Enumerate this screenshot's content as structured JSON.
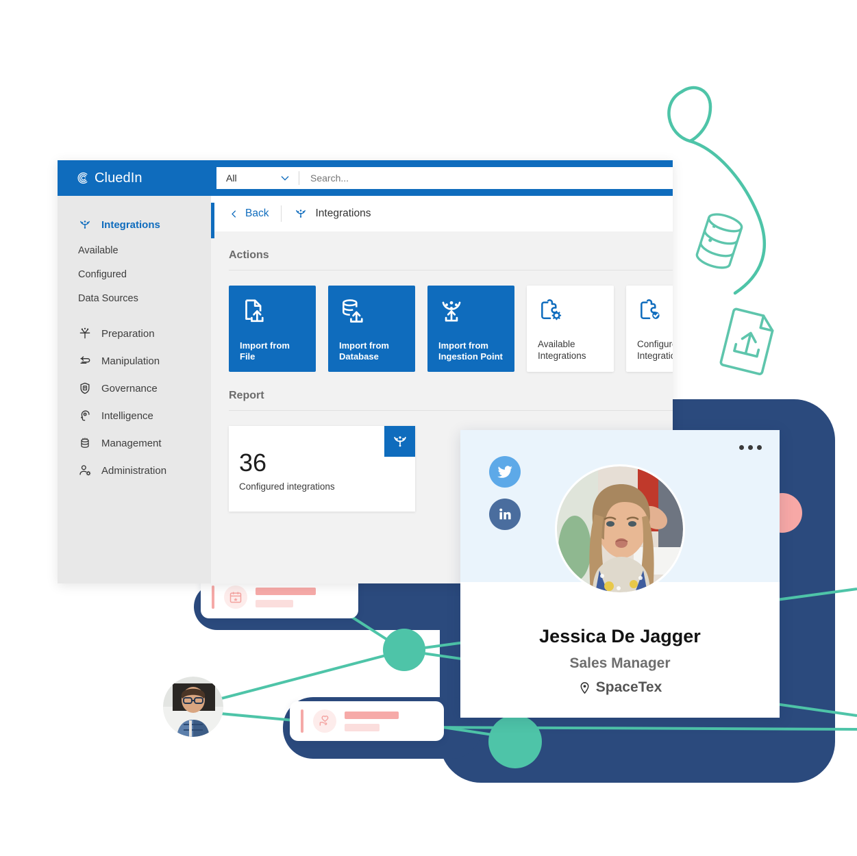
{
  "app": {
    "brand": "CluedIn",
    "brand_icon": "cluedin-logo-icon",
    "search": {
      "scope_value": "All",
      "scope_icon": "chevron-down-icon",
      "placeholder": "Search...",
      "value": ""
    },
    "topbar_color": "#0f6cbd"
  },
  "sidebar": {
    "active_item": "Integrations",
    "items": [
      {
        "label": "Integrations",
        "icon": "integrations-icon",
        "active": true
      },
      {
        "label": "Available",
        "icon": "",
        "sub": true
      },
      {
        "label": "Configured",
        "icon": "",
        "sub": true
      },
      {
        "label": "Data Sources",
        "icon": "",
        "sub": true
      },
      {
        "label": "Preparation",
        "icon": "preparation-icon"
      },
      {
        "label": "Manipulation",
        "icon": "manipulation-icon"
      },
      {
        "label": "Governance",
        "icon": "governance-shield-icon"
      },
      {
        "label": "Intelligence",
        "icon": "intelligence-brain-icon"
      },
      {
        "label": "Management",
        "icon": "management-database-icon"
      },
      {
        "label": "Administration",
        "icon": "administration-user-icon"
      }
    ]
  },
  "breadcrumb": {
    "back_label": "Back",
    "back_icon": "chevron-left-icon",
    "title": "Integrations",
    "title_icon": "integrations-icon"
  },
  "main": {
    "actions_heading": "Actions",
    "action_cards": [
      {
        "label": "Import from File",
        "icon": "file-upload-icon",
        "style": "blue"
      },
      {
        "label": "Import from Database",
        "icon": "database-upload-icon",
        "style": "blue"
      },
      {
        "label": "Import from Ingestion Point",
        "icon": "ingestion-point-icon",
        "style": "blue"
      },
      {
        "label": "Available Integrations",
        "icon": "puzzle-gear-icon",
        "style": "white"
      },
      {
        "label": "Configured Integrations",
        "icon": "puzzle-check-icon",
        "style": "white"
      }
    ],
    "report_heading": "Report",
    "report_card": {
      "value": "36",
      "caption": "Configured integrations",
      "badge_icon": "cluedin-mark-icon"
    }
  },
  "profile": {
    "name": "Jessica De Jagger",
    "role": "Sales Manager",
    "company": "SpaceTex",
    "company_icon": "location-pin-icon",
    "menu_icon": "more-options-icon",
    "social": [
      {
        "name": "twitter-icon",
        "color": "#5da9e8"
      },
      {
        "name": "linkedin-icon",
        "color": "#4a6d9e"
      }
    ],
    "avatar_icon": "profile-photo"
  },
  "graph": {
    "node_cards": [
      {
        "icon": "calendar-star-icon"
      },
      {
        "icon": "heart-hand-icon"
      }
    ],
    "person_avatar_icon": "person-photo",
    "accent_teal": "#4ec4a8",
    "accent_navy": "#2b4a7d",
    "accent_pink": "#f7a8a6"
  },
  "decorations": {
    "squiggle_icon": "squiggle-curve",
    "database_doodle_icon": "database-doodle-icon",
    "file_doodle_icon": "file-upload-doodle-icon"
  }
}
